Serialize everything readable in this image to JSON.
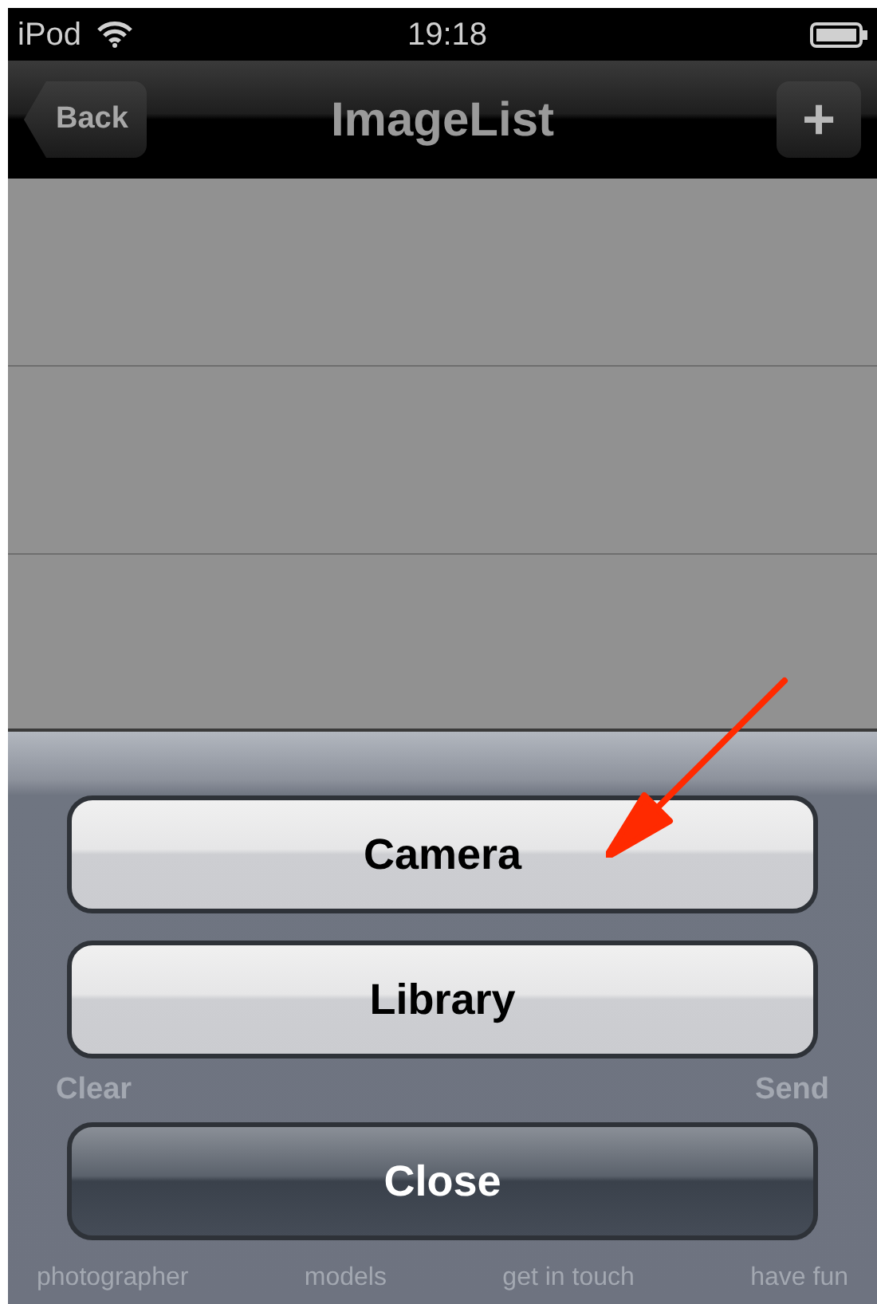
{
  "status_bar": {
    "carrier": "iPod",
    "time": "19:18"
  },
  "nav_bar": {
    "back": "Back",
    "title": "ImageList",
    "add": "+"
  },
  "sheet": {
    "buttons": [
      {
        "label": "Camera",
        "kind": "light"
      },
      {
        "label": "Library",
        "kind": "light"
      },
      {
        "label": "Close",
        "kind": "dark"
      }
    ]
  },
  "background_toolbar": {
    "left": "Clear",
    "right": "Send"
  },
  "background_tabs": [
    "photographer",
    "models",
    "get in touch",
    "have fun"
  ]
}
